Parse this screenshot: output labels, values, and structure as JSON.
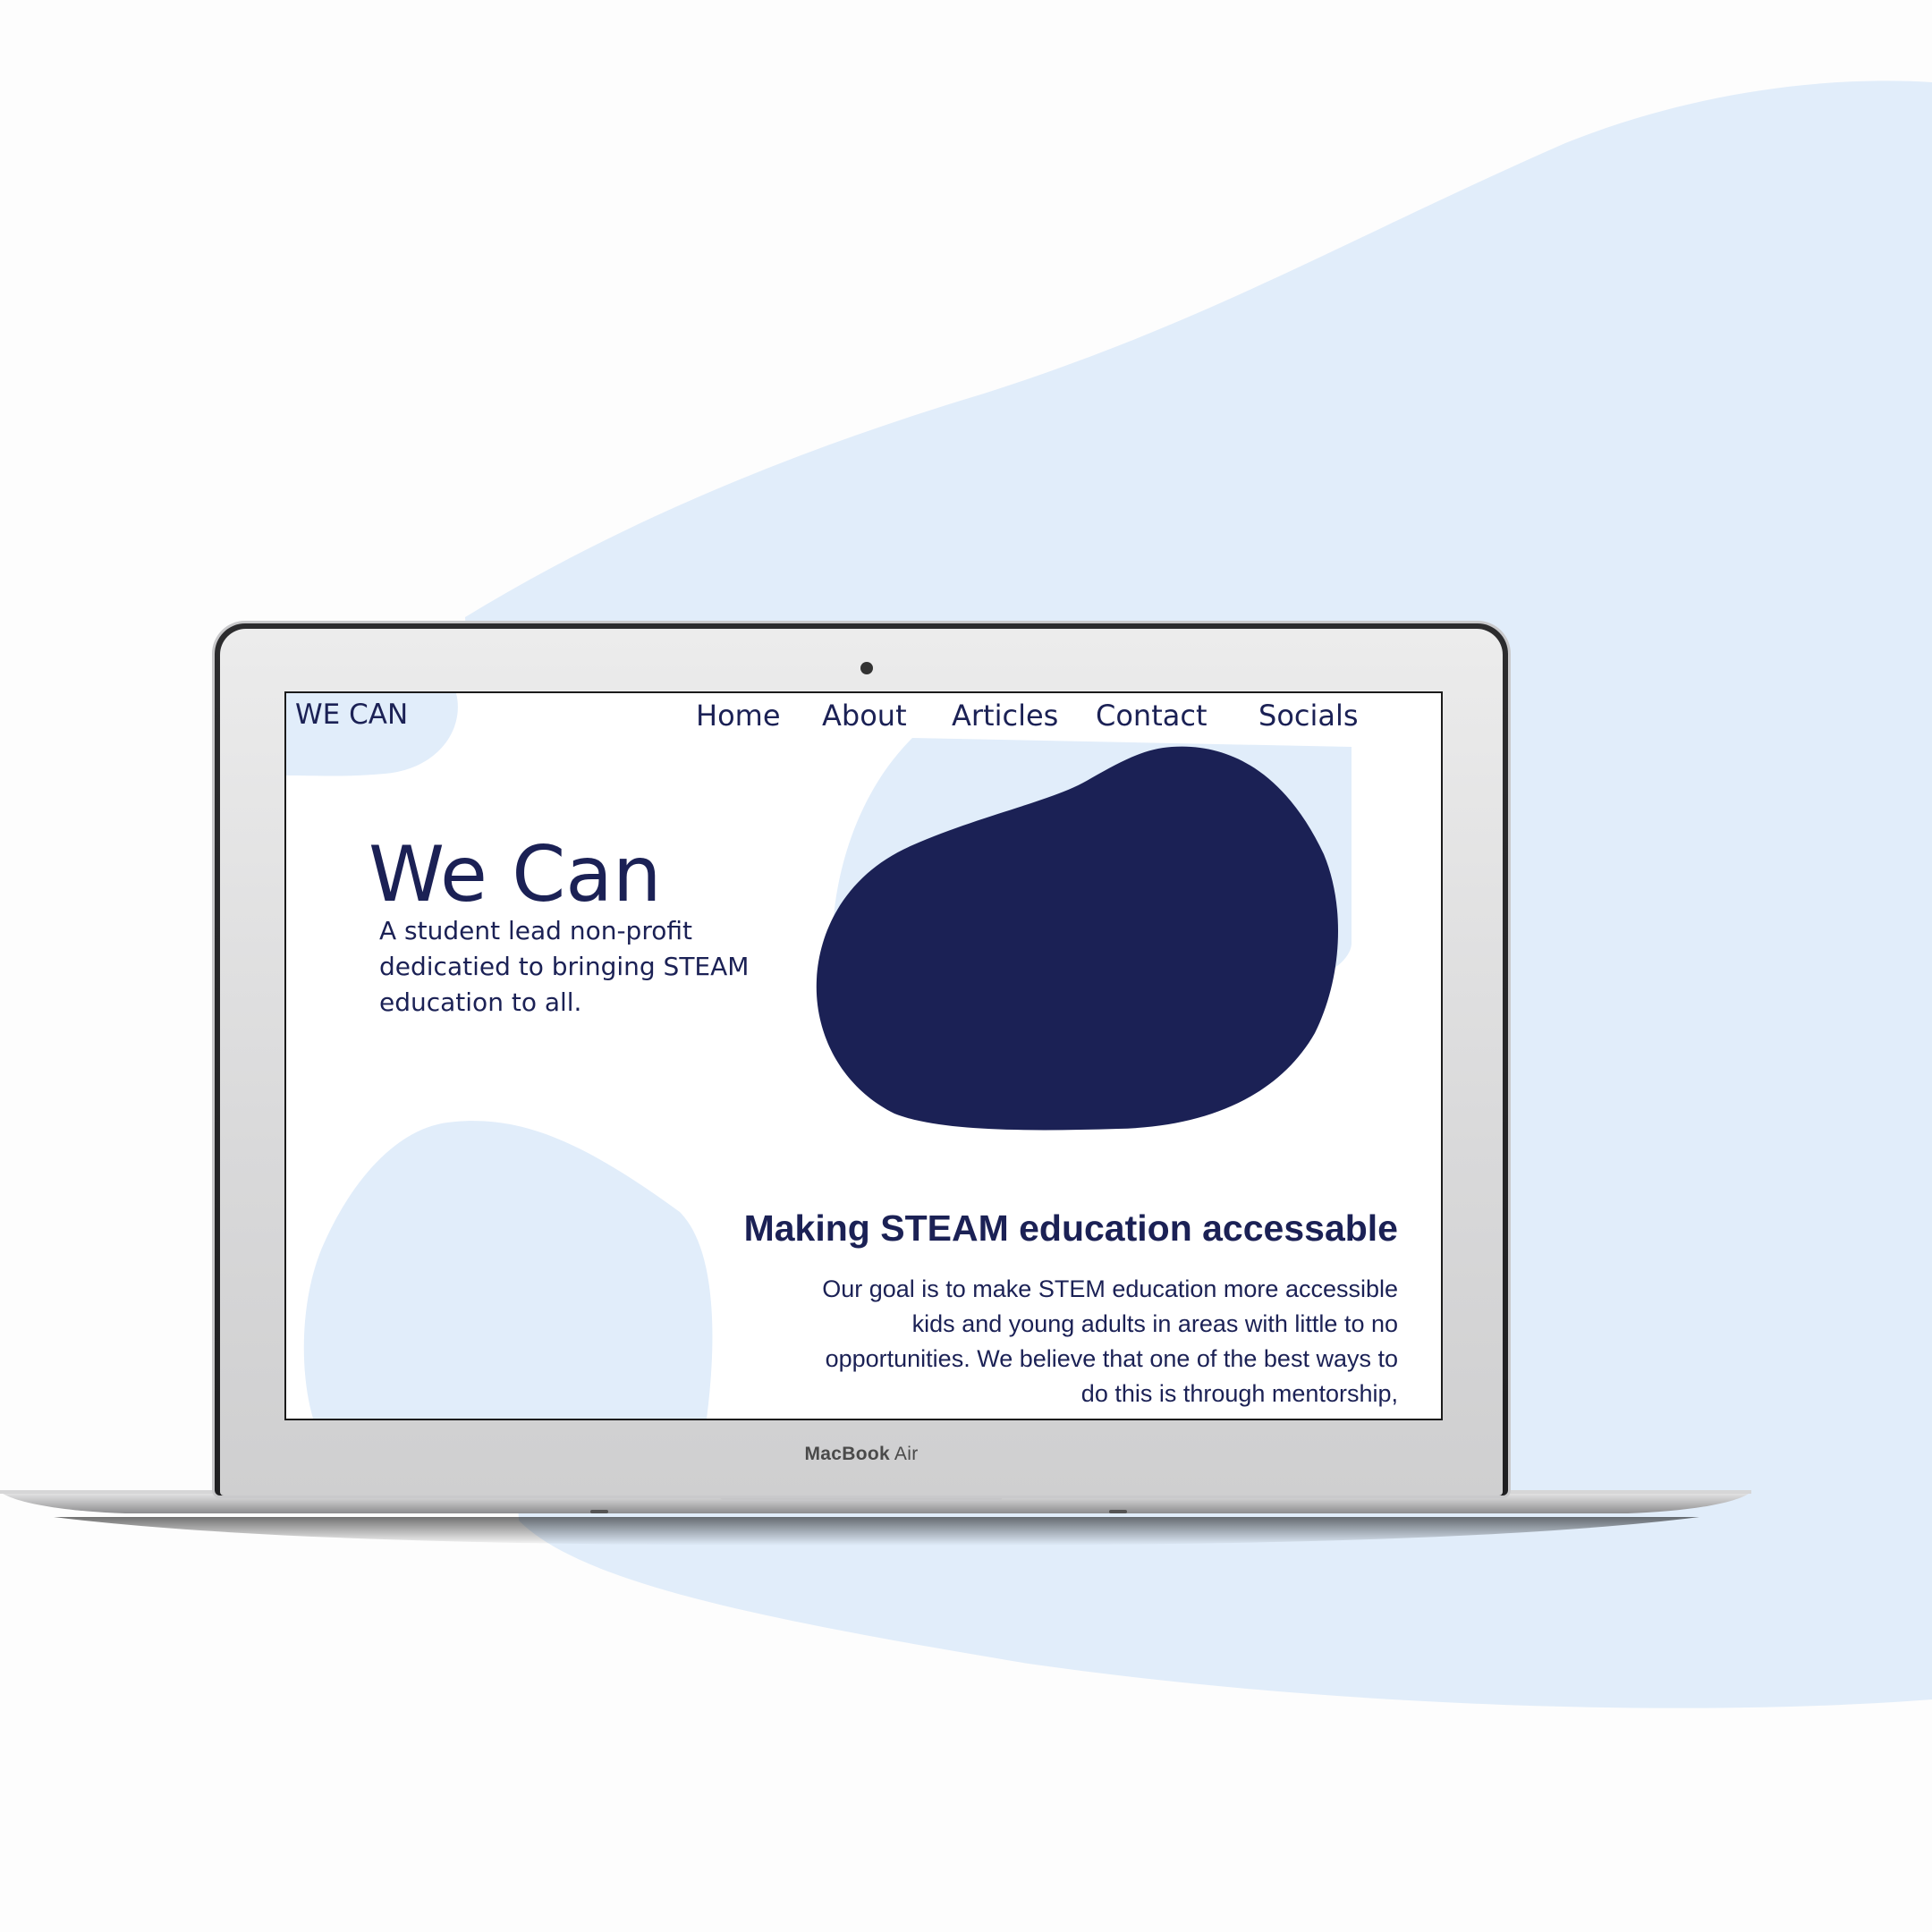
{
  "device": {
    "brand_bold": "MacBook",
    "brand_light": "Air"
  },
  "site": {
    "logo": "WE CAN",
    "nav": [
      "Home",
      "About",
      "Articles",
      "Contact",
      "Socials"
    ],
    "hero": {
      "title": "We Can",
      "subtitle": "A student lead non-profit dedicatied to bringing STEAM education to all."
    },
    "section": {
      "title": "Making STEAM education accessable",
      "body": "Our goal is to make STEM education more accessible kids and young adults in areas with little to no opportunities. We believe that one of the best ways to do this is through mentorship,"
    }
  },
  "colors": {
    "navy": "#1b2155",
    "light_blue": "#e1edfa",
    "background": "#fdfdfd"
  }
}
